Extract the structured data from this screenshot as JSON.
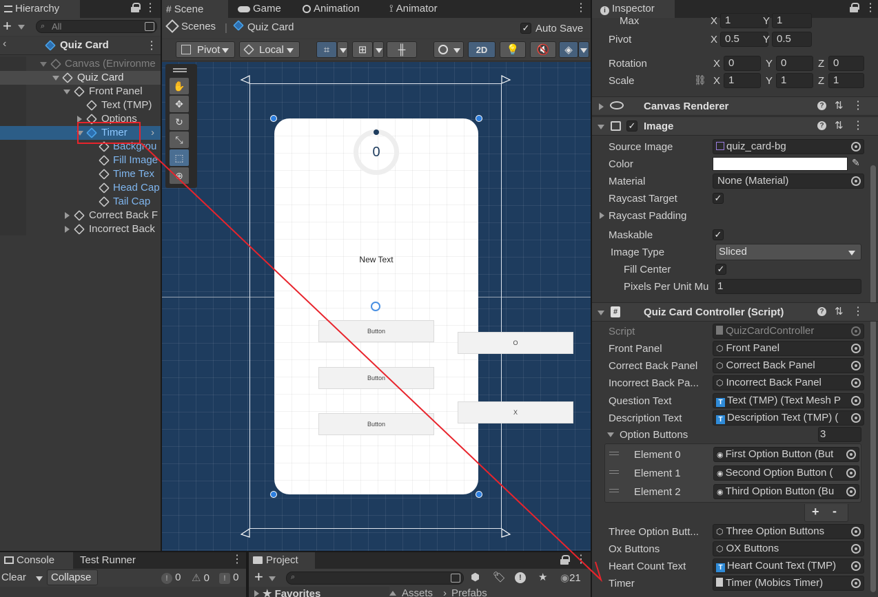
{
  "hierarchy": {
    "tab": "Hierarchy",
    "search_placeholder": "All",
    "breadcrumb": "Quiz Card",
    "items": [
      {
        "label": "Canvas (Environme"
      },
      {
        "label": "Quiz Card"
      },
      {
        "label": "Front Panel"
      },
      {
        "label": "Text (TMP)"
      },
      {
        "label": "Options"
      },
      {
        "label": "Timer"
      },
      {
        "label": "Backgrou"
      },
      {
        "label": "Fill Image"
      },
      {
        "label": "Time Tex"
      },
      {
        "label": "Head Cap"
      },
      {
        "label": "Tail Cap"
      },
      {
        "label": "Correct Back F"
      },
      {
        "label": "Incorrect Back"
      }
    ]
  },
  "scene": {
    "tabs": [
      "Scene",
      "Game",
      "Animation",
      "Animator"
    ],
    "breadcrumb_root": "Scenes",
    "breadcrumb_current": "Quiz Card",
    "auto_save": "Auto Save",
    "pivot": "Pivot",
    "local": "Local",
    "mode_2d": "2D",
    "card": {
      "timer_value": "0",
      "new_text": "New Text",
      "buttons": [
        "Button",
        "Button",
        "Button"
      ],
      "ox": [
        "O",
        "X"
      ]
    }
  },
  "inspector": {
    "tab": "Inspector",
    "rect": {
      "max_label": "Max",
      "max_x": "1",
      "max_y": "1",
      "pivot_label": "Pivot",
      "pivot_x": "0.5",
      "pivot_y": "0.5",
      "rotation_label": "Rotation",
      "rot_x": "0",
      "rot_y": "0",
      "rot_z": "0",
      "scale_label": "Scale",
      "scale_x": "1",
      "scale_y": "1",
      "scale_z": "1",
      "x": "X",
      "y": "Y",
      "z": "Z"
    },
    "canvas_renderer": "Canvas Renderer",
    "image": {
      "title": "Image",
      "source_image_label": "Source Image",
      "source_image": "quiz_card-bg",
      "color_label": "Color",
      "material_label": "Material",
      "material": "None (Material)",
      "raycast_target": "Raycast Target",
      "raycast_padding": "Raycast Padding",
      "maskable": "Maskable",
      "image_type_label": "Image Type",
      "image_type": "Sliced",
      "fill_center": "Fill Center",
      "ppu_label": "Pixels Per Unit Mu",
      "ppu": "1"
    },
    "controller": {
      "title": "Quiz Card Controller (Script)",
      "fields": [
        {
          "label": "Script",
          "value": "QuizCardController"
        },
        {
          "label": "Front Panel",
          "value": "Front Panel"
        },
        {
          "label": "Correct Back Panel",
          "value": "Correct Back Panel"
        },
        {
          "label": "Incorrect Back Pa...",
          "value": "Incorrect Back Panel"
        },
        {
          "label": "Question Text",
          "value": "Text (TMP) (Text Mesh P"
        },
        {
          "label": "Description Text",
          "value": "Description Text (TMP) ("
        }
      ],
      "option_buttons_label": "Option Buttons",
      "option_buttons_count": "3",
      "elements": [
        {
          "label": "Element 0",
          "value": "First Option Button (But"
        },
        {
          "label": "Element 1",
          "value": "Second Option Button ("
        },
        {
          "label": "Element 2",
          "value": "Third Option Button (Bu"
        }
      ],
      "plus": "+",
      "minus": "-",
      "fields2": [
        {
          "label": "Three Option Butt...",
          "value": "Three Option Buttons"
        },
        {
          "label": "Ox Buttons",
          "value": "OX Buttons"
        },
        {
          "label": "Heart Count Text",
          "value": "Heart Count Text (TMP)"
        },
        {
          "label": "Timer",
          "value": "Timer (Mobics Timer)"
        }
      ]
    }
  },
  "console": {
    "tabs": [
      "Console",
      "Test Runner"
    ],
    "clear": "Clear",
    "collapse": "Collapse",
    "counts": [
      "0",
      "0",
      "0"
    ]
  },
  "project": {
    "tab": "Project",
    "favorites": "Favorites",
    "path": [
      "Assets",
      "Prefabs"
    ],
    "hidden_count": "21"
  },
  "colors": {
    "scene_bg": "#1e3c5e",
    "annotation": "#e8242c",
    "selected_row": "#2c5d87",
    "panel_bg": "#383838"
  }
}
